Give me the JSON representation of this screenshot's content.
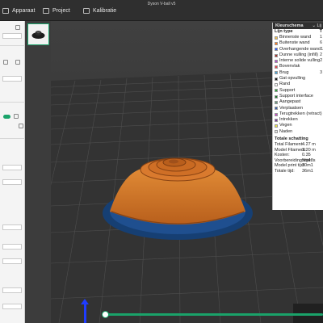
{
  "window": {
    "title": "Dyson V-ball v5"
  },
  "tabs": [
    {
      "label": "Apparaat"
    },
    {
      "label": "Project"
    },
    {
      "label": "Kalibratie"
    }
  ],
  "legend": {
    "header": "Kleurschema",
    "dropdown_value": "Lij",
    "column_type": "Lijn type",
    "column_time": "T",
    "items": [
      {
        "label": "Binnenste wand",
        "color": "#f2c14e",
        "value": "1"
      },
      {
        "label": "Buitenste wand",
        "color": "#ff7b1f",
        "value": "6"
      },
      {
        "label": "Overhangende wand",
        "color": "#2b5cff",
        "value": "1"
      },
      {
        "label": "Dunne vulling (infill)",
        "color": "#a8322b",
        "value": "2"
      },
      {
        "label": "Interne solide vulling",
        "color": "#b34fd1",
        "value": "2"
      },
      {
        "label": "Bovenvlak",
        "color": "#e8444a",
        "value": ""
      },
      {
        "label": "Brug",
        "color": "#4aa6d6",
        "value": "3"
      },
      {
        "label": "Gat opvulling",
        "color": "#1a1a1a",
        "value": ""
      },
      {
        "label": "Rand",
        "color": "#ffffff",
        "value": ""
      },
      {
        "label": "Support",
        "color": "#2fa83a",
        "value": ""
      },
      {
        "label": "Support interface",
        "color": "#1f7a2d",
        "value": ""
      },
      {
        "label": "Aangepast",
        "color": "#6a9a82",
        "value": ""
      },
      {
        "label": "Verplaatsen",
        "color": "#3a5fa8",
        "value": ""
      },
      {
        "label": "Terugtrekken (retract)",
        "color": "#c44fc4",
        "value": ""
      },
      {
        "label": "Intrekken",
        "color": "#7b3fa0",
        "value": ""
      },
      {
        "label": "Vegen",
        "color": "#f0e84a",
        "value": ""
      },
      {
        "label": "Naden",
        "color": "#e6e6e6",
        "value": ""
      }
    ],
    "summary_title": "Totale schatting",
    "stats": [
      {
        "label": "Total Filament:",
        "value": "4.27 m"
      },
      {
        "label": "Model Filament:",
        "value": "3.20 m"
      },
      {
        "label": "Kosten:",
        "value": "0.35"
      },
      {
        "label": "Voorbereidingstijd:",
        "value": "5m48s"
      },
      {
        "label": "Model print tijd:",
        "value": "30m1"
      },
      {
        "label": "Totale tijd:",
        "value": "36m1"
      }
    ]
  },
  "colors": {
    "accent": "#1aa36a",
    "model": "#d9782b",
    "plate_border": "#1f4f8f"
  }
}
